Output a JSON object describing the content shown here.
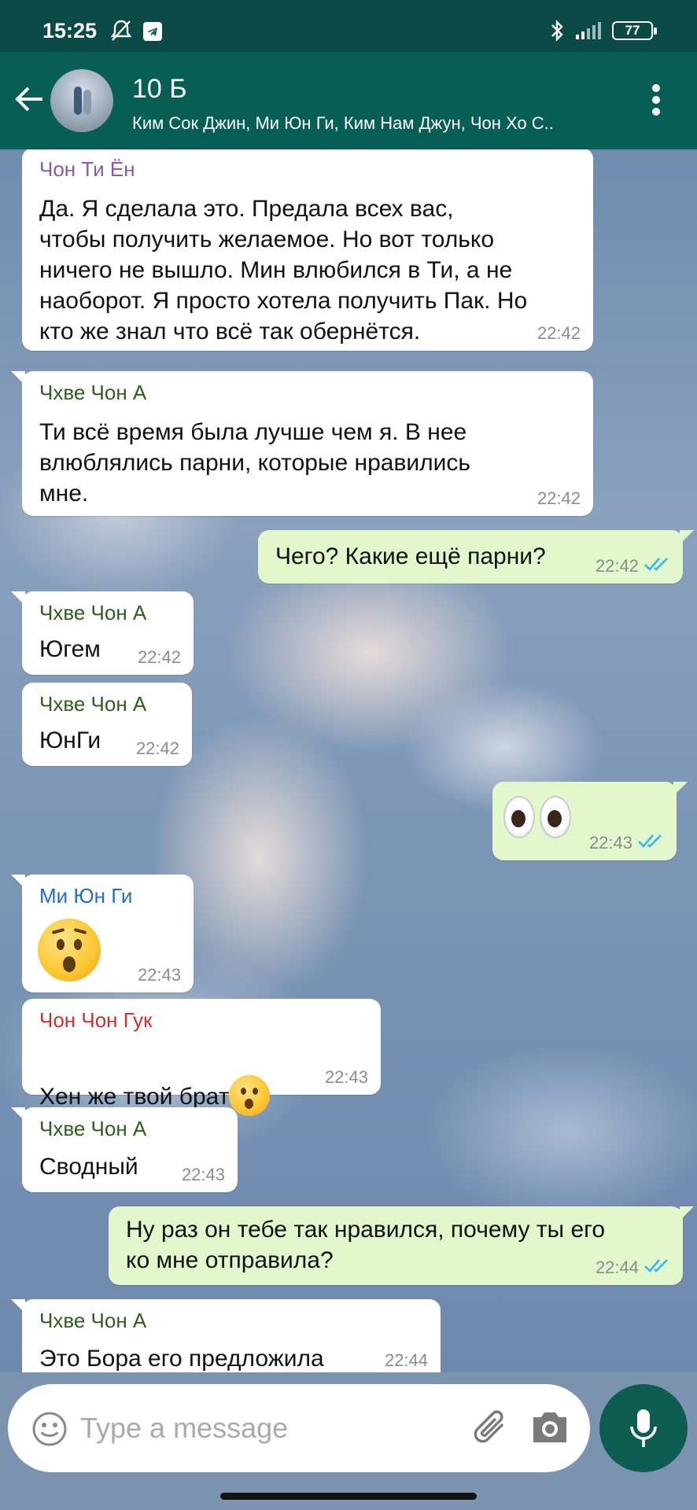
{
  "status_bar": {
    "time": "15:25",
    "battery": "77"
  },
  "header": {
    "title": "10 Б",
    "subtitle": "Ким Сок Джин, Ми Юн Ги, Ким Нам Джун, Чон Хо С..",
    "icons": [
      "back-arrow-icon",
      "avatar",
      "more-vert-icon"
    ]
  },
  "messages": [
    {
      "direction": "in",
      "sender": "Чон Ти Ён",
      "sender_color": "#8a5aa8",
      "text": "Да. Я сделала это. Предала всех вас,\nчтобы получить желаемое. Но вот только\nничего не вышло. Мин влюбился в Ти, а не\nнаоборот. Я просто хотела получить Пак. Но\nкто же знал что всё так обернётся.",
      "time": "22:42"
    },
    {
      "direction": "in",
      "sender": "Чхве Чон А",
      "sender_color": "#2e5f1f",
      "text": "Ти всё время была лучше чем я. В нее\nвлюблялись парни, которые нравились\nмне.",
      "time": "22:42"
    },
    {
      "direction": "out",
      "text": "Чего? Какие ещё парни?",
      "time": "22:42",
      "read": true
    },
    {
      "direction": "in",
      "sender": "Чхве Чон А",
      "sender_color": "#2e5f1f",
      "text": "Югем",
      "time": "22:42"
    },
    {
      "direction": "in",
      "sender": "Чхве Чон А",
      "sender_color": "#2e5f1f",
      "text": "ЮнГи",
      "time": "22:42"
    },
    {
      "direction": "out",
      "emoji": "eyes",
      "time": "22:43",
      "read": true
    },
    {
      "direction": "in",
      "sender": "Ми Юн Ги",
      "sender_color": "#1e6fc4",
      "emoji": "hushed-face",
      "time": "22:43"
    },
    {
      "direction": "in",
      "sender": "Чон Чон Гук",
      "sender_color": "#d32f2f",
      "text": "Хен же твой брат",
      "emoji": "hushed-face",
      "time": "22:43"
    },
    {
      "direction": "in",
      "sender": "Чхве Чон А",
      "sender_color": "#2e5f1f",
      "text": "Сводный",
      "time": "22:43"
    },
    {
      "direction": "out",
      "text": "Ну раз он тебе так нравился, почему ты его\nко мне отправила?",
      "time": "22:44",
      "read": true
    },
    {
      "direction": "in",
      "sender": "Чхве Чон А",
      "sender_color": "#2e5f1f",
      "text": "Это Бора его предложила",
      "time": "22:44"
    }
  ],
  "composer": {
    "placeholder": "Type a message",
    "icons": [
      "emoji-icon",
      "attach-icon",
      "camera-icon",
      "mic-icon"
    ]
  },
  "colors": {
    "header": "#075e54",
    "status_bar": "#0b4a46",
    "outgoing_bubble": "#e2f7cb",
    "incoming_bubble": "#ffffff",
    "read_tick": "#34b7f1"
  }
}
